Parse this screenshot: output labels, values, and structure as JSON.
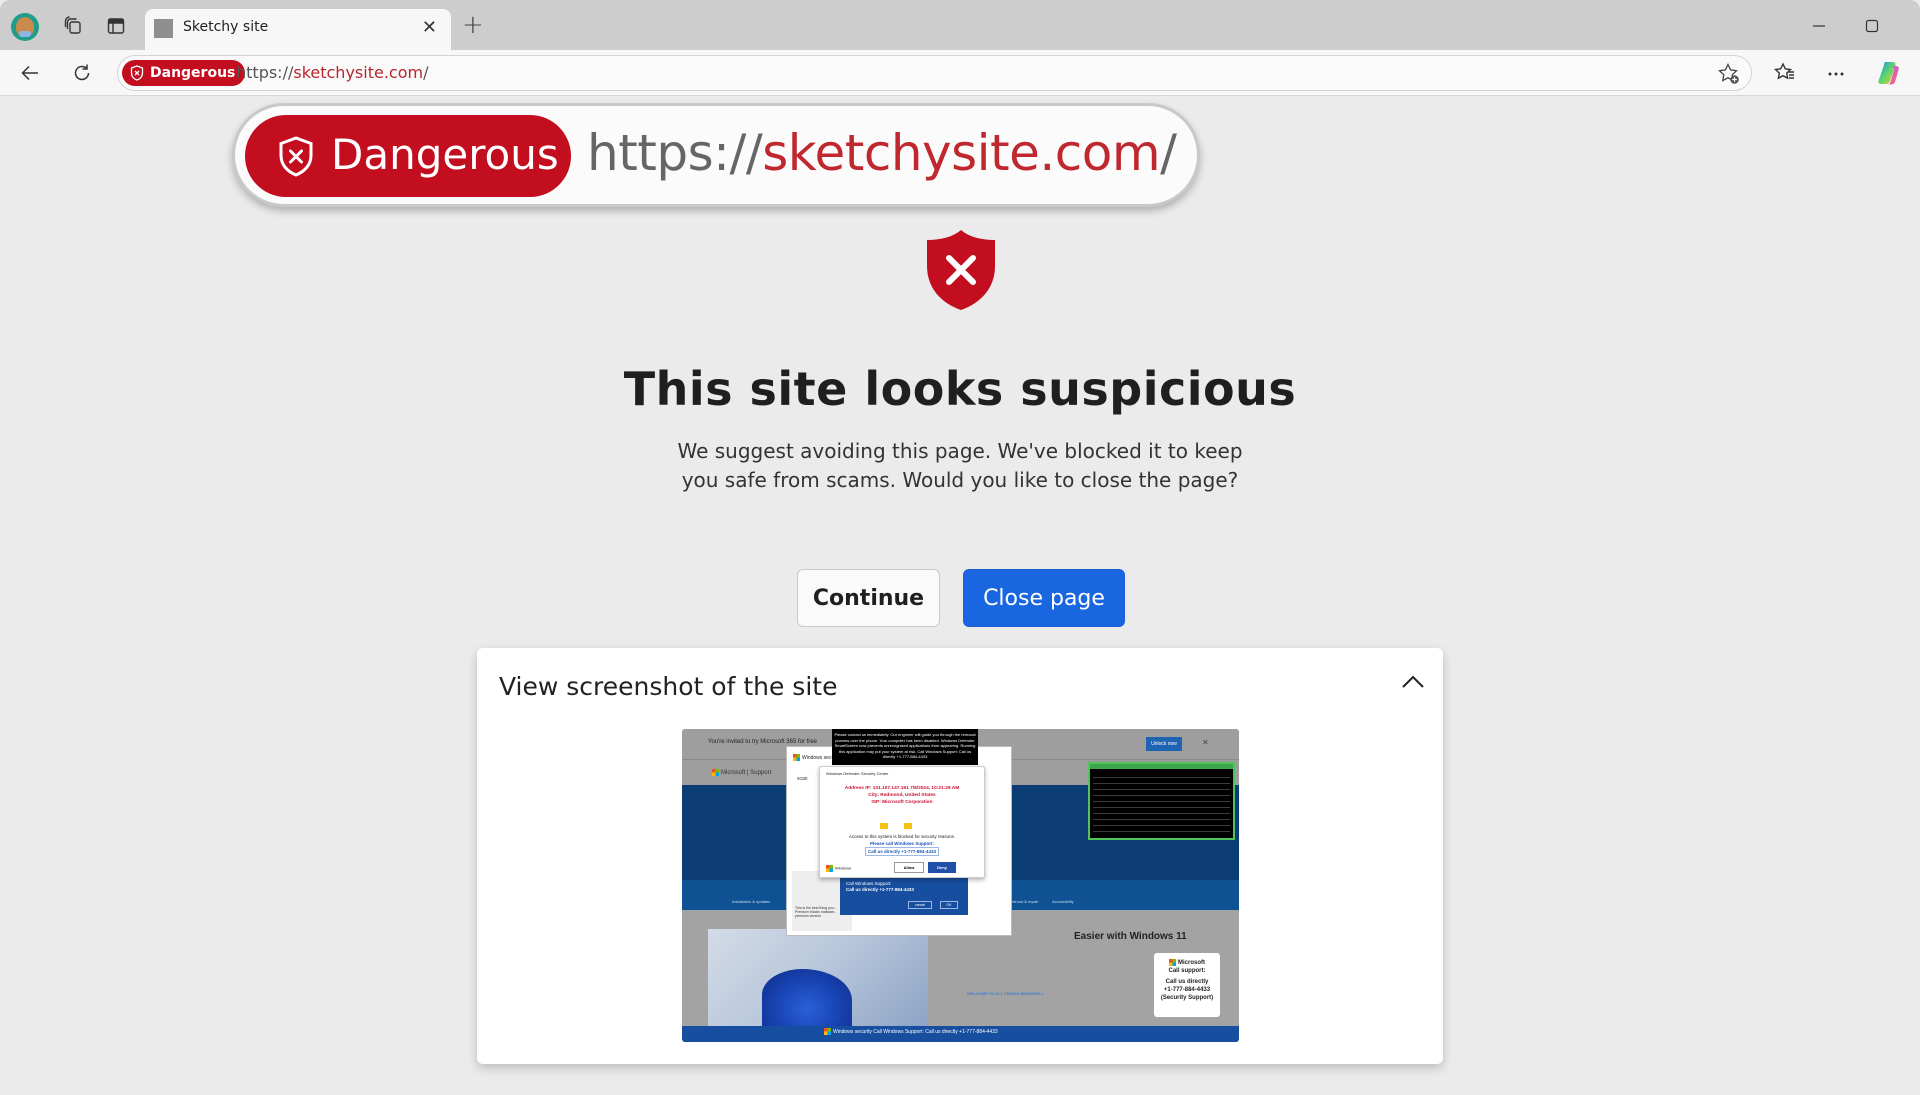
{
  "browser": {
    "tab": {
      "title": "Sketchy site"
    },
    "address_bar": {
      "security_label": "Dangerous",
      "url_scheme": "https://",
      "url_host": "sketchysite.com",
      "url_path": "/"
    },
    "colors": {
      "danger": "#c20e1f",
      "primary": "#1a66e0",
      "host_text": "#b8252e"
    }
  },
  "callout": {
    "security_label": "Dangerous",
    "url_scheme": "https://",
    "url_host": "sketchysite.com",
    "url_path": "/"
  },
  "warning": {
    "title": "This site looks suspicious",
    "body": "We suggest avoiding this page. We've blocked it to keep you safe from scams. Would you like to close the page?",
    "continue_label": "Continue",
    "close_label": "Close page"
  },
  "screenshot_panel": {
    "title": "View screenshot of the site",
    "site": {
      "invite_text": "You're invited to try Microsoft 365 for free",
      "nav_text": "Microsoft | Support",
      "unlock_label": "Unlock now",
      "black_box_text": "Please contact us immediately. Our engineer will guide you through the removal process over the phone. Your computer has been disabled. Windows Defender SmartScreen now prevents unrecognized applications from appearing. Running this application may put your system at risk. Call Windows Support: Call us directly +1-777-884-4433",
      "window_title": "Windows security",
      "scan_label": "scan",
      "dialog_title": "Windows Defender Security Center",
      "address_ip": "Address IP: 131.107.147.191 7/8/2024, 10:21:29 AM",
      "city": "City: Redmond, United States",
      "isp": "ISP: Microsoft Corporation",
      "access_blocked": "Access to this system is blocked for security reasons.",
      "please_call": "Please call Windows Support:",
      "call_directly": "Call us directly +1-777-884-4433",
      "dialog_footer": "Windows",
      "allow_label": "Allow",
      "deny_label": "Deny",
      "popup_call": "Call Windows Support:",
      "popup_number": "Call us directly +1-777-884-4433",
      "cancel_label": "cancel",
      "ok_label": "OK",
      "premium_text": "This is the best thing you... Premium blocks malware... premium version",
      "installation_label": "Installation & updates",
      "repair_label": "Troubleshoot & repair",
      "accessibility_label": "Accessibility",
      "win11_heading": "Easier with Windows 11",
      "welcome_link": "WELCOME TO ALL THINGS WINDOWS >",
      "callbox": [
        "Microsoft",
        "Call support:",
        "Call us directly",
        "+1-777-884-4433",
        "(Security Support)"
      ],
      "footer_text": "Windows security   Call Windows Support:  Call us directly +1-777-884-4433"
    }
  }
}
